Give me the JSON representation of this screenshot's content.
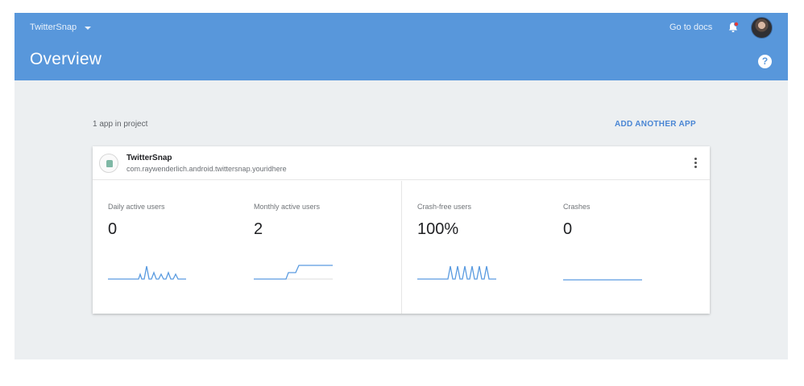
{
  "topbar": {
    "project_name": "TwitterSnap",
    "page_title": "Overview",
    "docs_link": "Go to docs",
    "icons": [
      "chevron-down-icon",
      "bell-icon",
      "avatar",
      "help-icon"
    ]
  },
  "content": {
    "app_count": "1 app in project",
    "add_app_label": "ADD ANOTHER APP"
  },
  "app_card": {
    "name": "TwitterSnap",
    "package": "com.raywenderlich.android.twittersnap.youridhere",
    "metrics": [
      {
        "label": "Daily active users",
        "value": "0"
      },
      {
        "label": "Monthly active users",
        "value": "2"
      },
      {
        "label": "Crash-free users",
        "value": "100%"
      },
      {
        "label": "Crashes",
        "value": "0"
      }
    ]
  },
  "colors": {
    "header": "#5897db",
    "background": "#eceff1",
    "accent": "#4a86d4",
    "sparkline": "#5a9be0"
  }
}
